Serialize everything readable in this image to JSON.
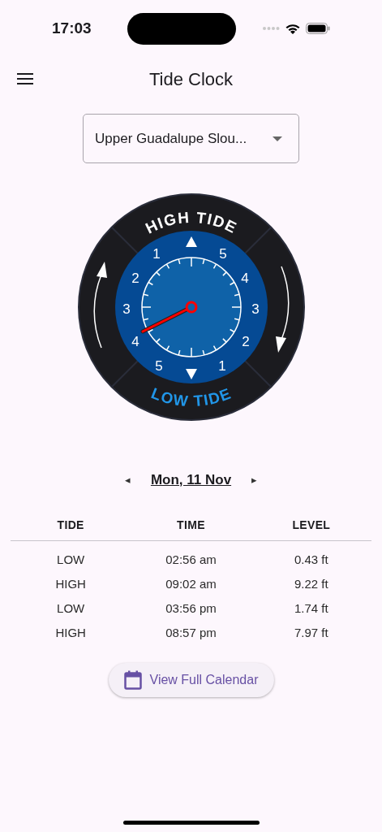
{
  "status_bar": {
    "time": "17:03"
  },
  "app_bar": {
    "title": "Tide Clock"
  },
  "location_dropdown": {
    "value": "Upper Guadalupe Slou..."
  },
  "tide_clock": {
    "top_label": "HIGH TIDE",
    "bottom_label": "LOW TIDE",
    "left_numbers": [
      "1",
      "2",
      "3",
      "4",
      "5"
    ],
    "right_numbers": [
      "5",
      "4",
      "3",
      "2",
      "1"
    ]
  },
  "date_nav": {
    "prev": "◂",
    "date": "Mon, 11 Nov",
    "next": "▸"
  },
  "table": {
    "columns": [
      "TIDE",
      "TIME",
      "LEVEL"
    ],
    "rows": [
      [
        "LOW",
        "02:56 am",
        "0.43 ft"
      ],
      [
        "HIGH",
        "09:02 am",
        "9.22 ft"
      ],
      [
        "LOW",
        "03:56 pm",
        "1.74 ft"
      ],
      [
        "HIGH",
        "08:57 pm",
        "7.97 ft"
      ]
    ]
  },
  "calendar_button": {
    "label": "View Full Calendar"
  }
}
